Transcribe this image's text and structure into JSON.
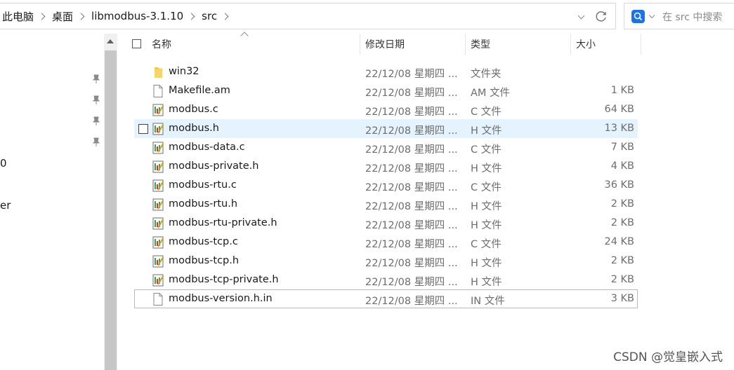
{
  "address_bar": {
    "breadcrumbs": [
      "此电脑",
      "桌面",
      "libmodbus-3.1.10",
      "src"
    ]
  },
  "search": {
    "placeholder": "在 src 中搜索"
  },
  "nav_fragments": [
    "0",
    "er"
  ],
  "columns": {
    "name": "名称",
    "date": "修改日期",
    "type": "类型",
    "size": "大小"
  },
  "files": [
    {
      "name": "win32",
      "date": "22/12/08 星期四 ...",
      "type": "文件夹",
      "size": "",
      "icon": "folder-icon"
    },
    {
      "name": "Makefile.am",
      "date": "22/12/08 星期四 ...",
      "type": "AM 文件",
      "size": "1 KB",
      "icon": "generic-file-icon"
    },
    {
      "name": "modbus.c",
      "date": "22/12/08 星期四 ...",
      "type": "C 文件",
      "size": "64 KB",
      "icon": "source-file-icon"
    },
    {
      "name": "modbus.h",
      "date": "22/12/08 星期四 ...",
      "type": "H 文件",
      "size": "13 KB",
      "icon": "source-file-icon"
    },
    {
      "name": "modbus-data.c",
      "date": "22/12/08 星期四 ...",
      "type": "C 文件",
      "size": "7 KB",
      "icon": "source-file-icon"
    },
    {
      "name": "modbus-private.h",
      "date": "22/12/08 星期四 ...",
      "type": "H 文件",
      "size": "4 KB",
      "icon": "source-file-icon"
    },
    {
      "name": "modbus-rtu.c",
      "date": "22/12/08 星期四 ...",
      "type": "C 文件",
      "size": "36 KB",
      "icon": "source-file-icon"
    },
    {
      "name": "modbus-rtu.h",
      "date": "22/12/08 星期四 ...",
      "type": "H 文件",
      "size": "2 KB",
      "icon": "source-file-icon"
    },
    {
      "name": "modbus-rtu-private.h",
      "date": "22/12/08 星期四 ...",
      "type": "H 文件",
      "size": "2 KB",
      "icon": "source-file-icon"
    },
    {
      "name": "modbus-tcp.c",
      "date": "22/12/08 星期四 ...",
      "type": "C 文件",
      "size": "24 KB",
      "icon": "source-file-icon"
    },
    {
      "name": "modbus-tcp.h",
      "date": "22/12/08 星期四 ...",
      "type": "H 文件",
      "size": "2 KB",
      "icon": "source-file-icon"
    },
    {
      "name": "modbus-tcp-private.h",
      "date": "22/12/08 星期四 ...",
      "type": "H 文件",
      "size": "2 KB",
      "icon": "source-file-icon"
    },
    {
      "name": "modbus-version.h.in",
      "date": "22/12/08 星期四 ...",
      "type": "IN 文件",
      "size": "3 KB",
      "icon": "generic-file-icon"
    }
  ],
  "hover_row_index": 3,
  "focus_row_index": 12,
  "watermark": "CSDN @觉皇嵌入式",
  "colors": {
    "hover": "#e5f3ff",
    "focus_border": "#99c2d6",
    "search_accent": "#1a73e8",
    "folder": "#f2c94c",
    "source_icon": "#3fa34d"
  }
}
